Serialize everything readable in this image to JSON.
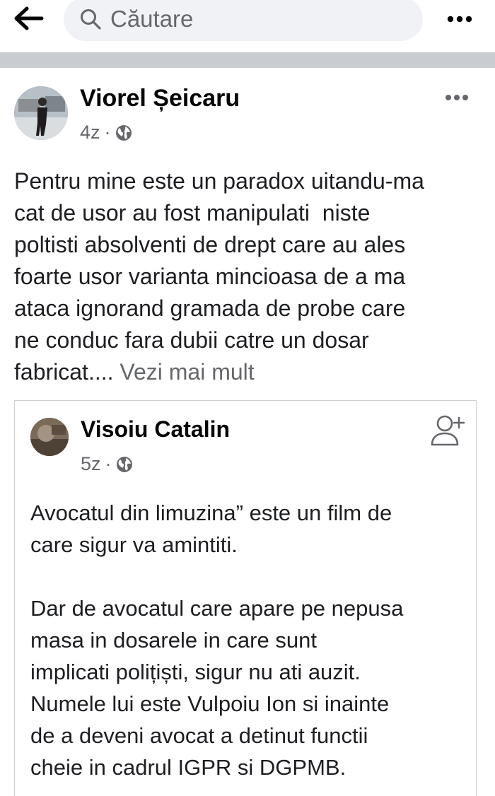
{
  "search": {
    "placeholder": "Căutare"
  },
  "post": {
    "author": "Viorel Șeicaru",
    "time": "4z",
    "meta_separator": "·",
    "text_lines": [
      "Pentru mine este un paradox uitandu-ma",
      "cat de usor au fost manipulati  niste",
      "poltisti absolventi de drept care au ales",
      "foarte usor varianta mincioasa de a ma",
      "ataca ignorand gramada de probe care",
      "ne conduc fara dubii catre un dosar"
    ],
    "last_line": "fabricat....",
    "see_more": "Vezi mai mult"
  },
  "shared": {
    "author": "Visoiu Catalin",
    "time": "5z",
    "meta_separator": "·",
    "paragraph1": [
      "Avocatul din limuzina” este un film de",
      "care sigur va amintiti."
    ],
    "paragraph2": [
      "Dar de avocatul care apare pe nepusa",
      "masa in dosarele in care sunt",
      "implicati polițiști, sigur nu ati auzit.",
      "Numele lui este Vulpoiu Ion si inainte",
      "de a deveni avocat a detinut functii",
      "cheie in cadrul IGPR si DGPMB."
    ]
  },
  "icons": {
    "back": "arrow-left-icon",
    "search": "search-icon",
    "more": "more-horizontal-icon",
    "privacy": "globe-icon",
    "add_friend": "add-friend-icon"
  },
  "colors": {
    "text": "#1c1e21",
    "secondary": "#65676b",
    "search_bg": "#f0f2f5",
    "separator": "#c9ccd1"
  }
}
